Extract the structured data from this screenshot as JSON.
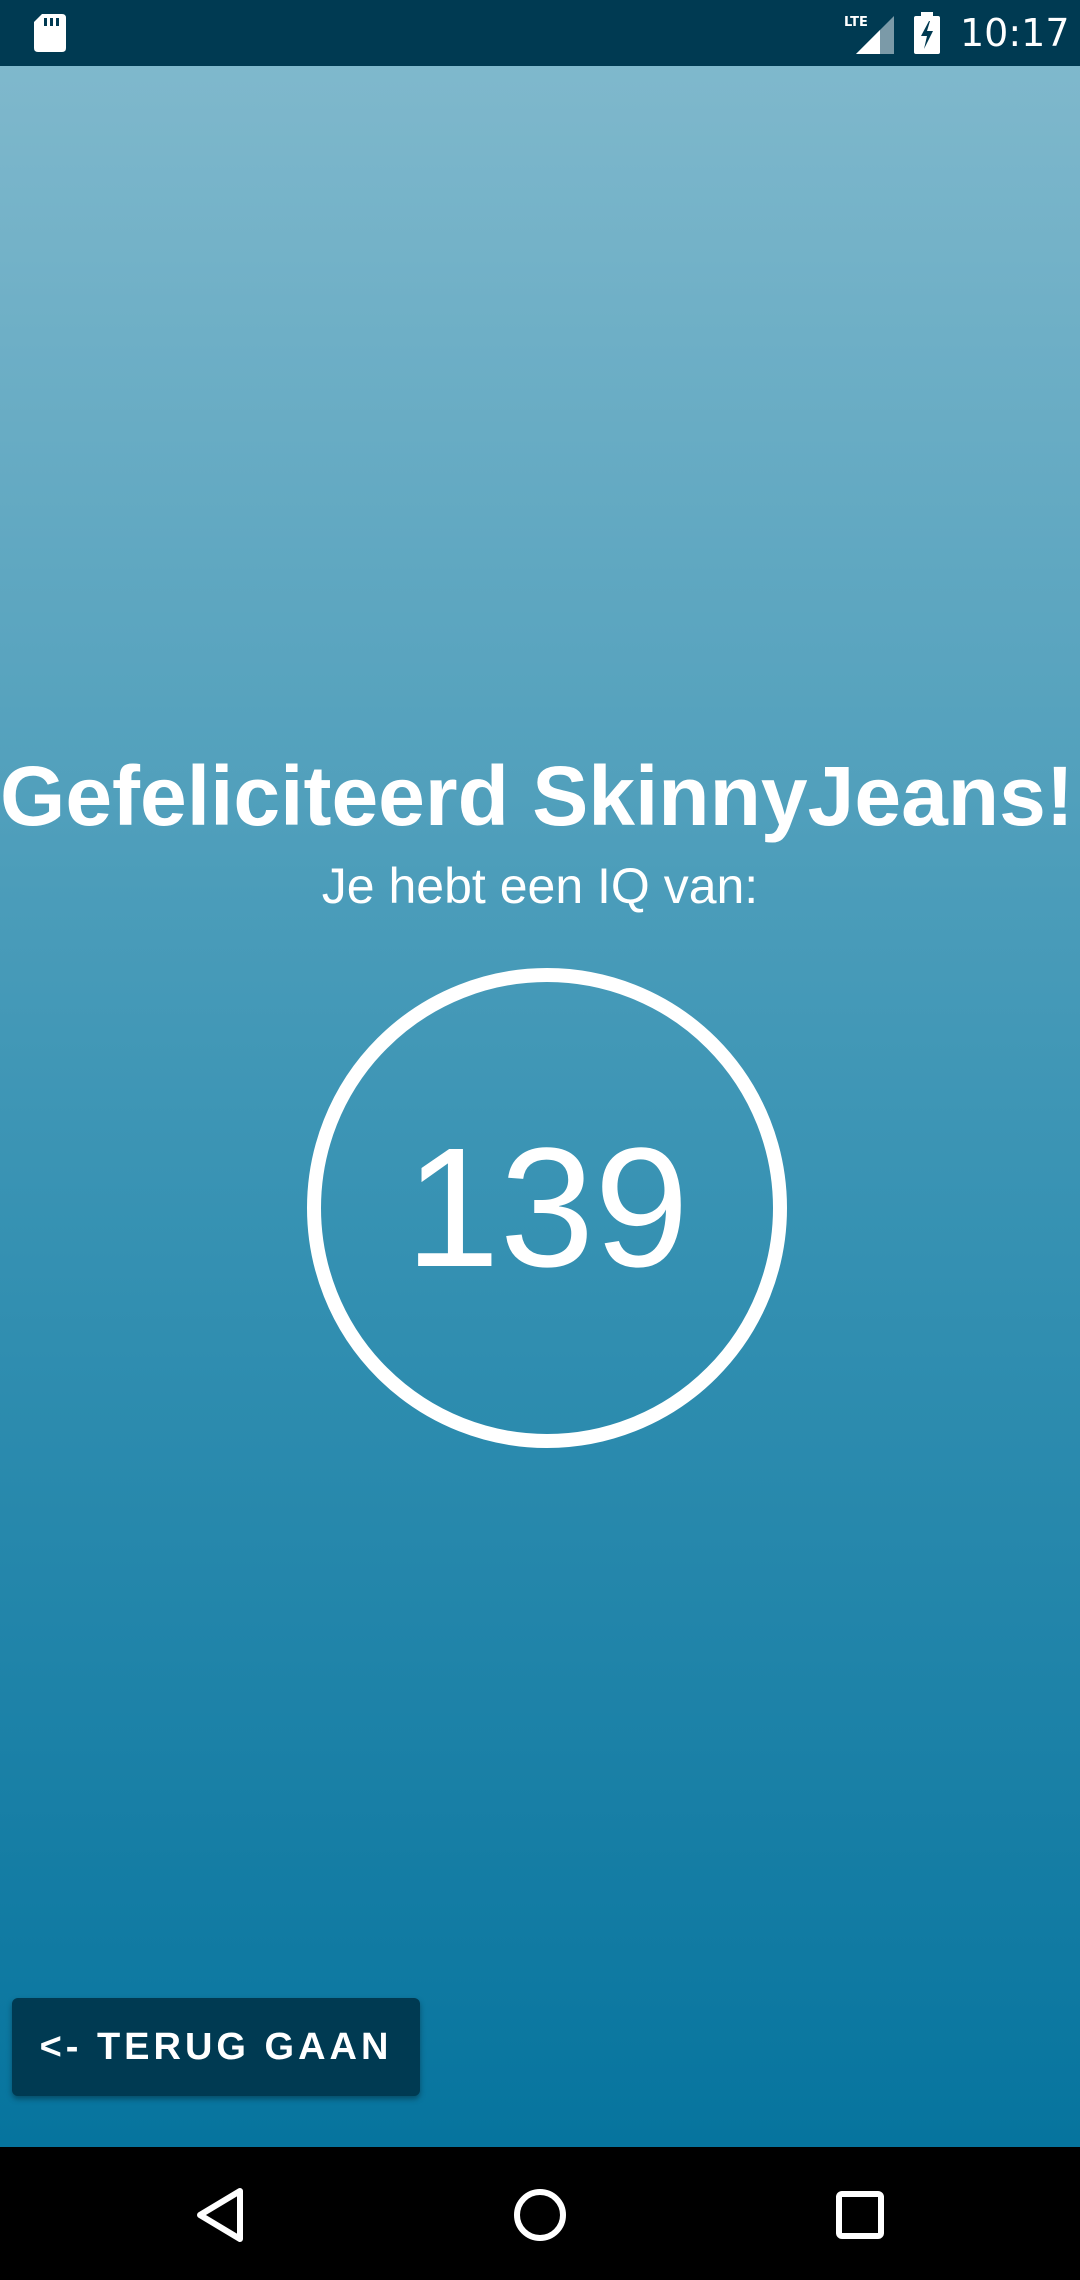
{
  "status_bar": {
    "time": "10:17",
    "network_label": "LTE",
    "icons": [
      "sd-card-icon",
      "lte-signal-icon",
      "battery-charging-icon"
    ]
  },
  "result": {
    "title": "Gefeliciteerd SkinnyJeans!!",
    "subtitle": "Je hebt een IQ van:",
    "iq_value": "139"
  },
  "actions": {
    "back_label": "<- TERUG GAAN"
  },
  "nav_bar": {
    "icons": [
      "back-icon",
      "home-icon",
      "recents-icon"
    ]
  },
  "colors": {
    "status_bar": "#003a52",
    "gradient_top": "#7fb8cc",
    "gradient_bottom": "#06749e",
    "button": "#003a52",
    "text": "#ffffff"
  }
}
